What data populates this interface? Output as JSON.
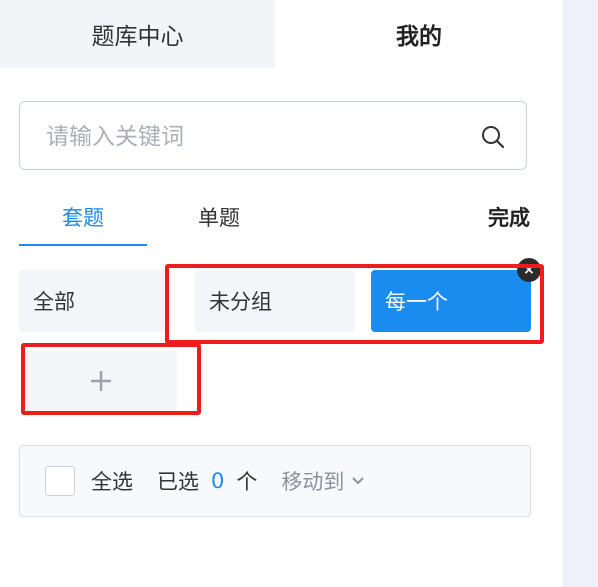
{
  "tabs": {
    "bank_center": "题库中心",
    "mine": "我的"
  },
  "search": {
    "placeholder": "请输入关键词"
  },
  "sub_tabs": {
    "set": "套题",
    "single": "单题"
  },
  "done_label": "完成",
  "groups": {
    "all": "全部",
    "ungrouped": "未分组",
    "each": "每一个",
    "close_glyph": "×",
    "add_glyph": "+"
  },
  "bottom": {
    "select_all": "全选",
    "selected_prefix": "已选",
    "count": "0",
    "unit": "个",
    "move_to": "移动到"
  },
  "colors": {
    "accent": "#1a8cf0",
    "highlight": "#ee1c1c"
  }
}
